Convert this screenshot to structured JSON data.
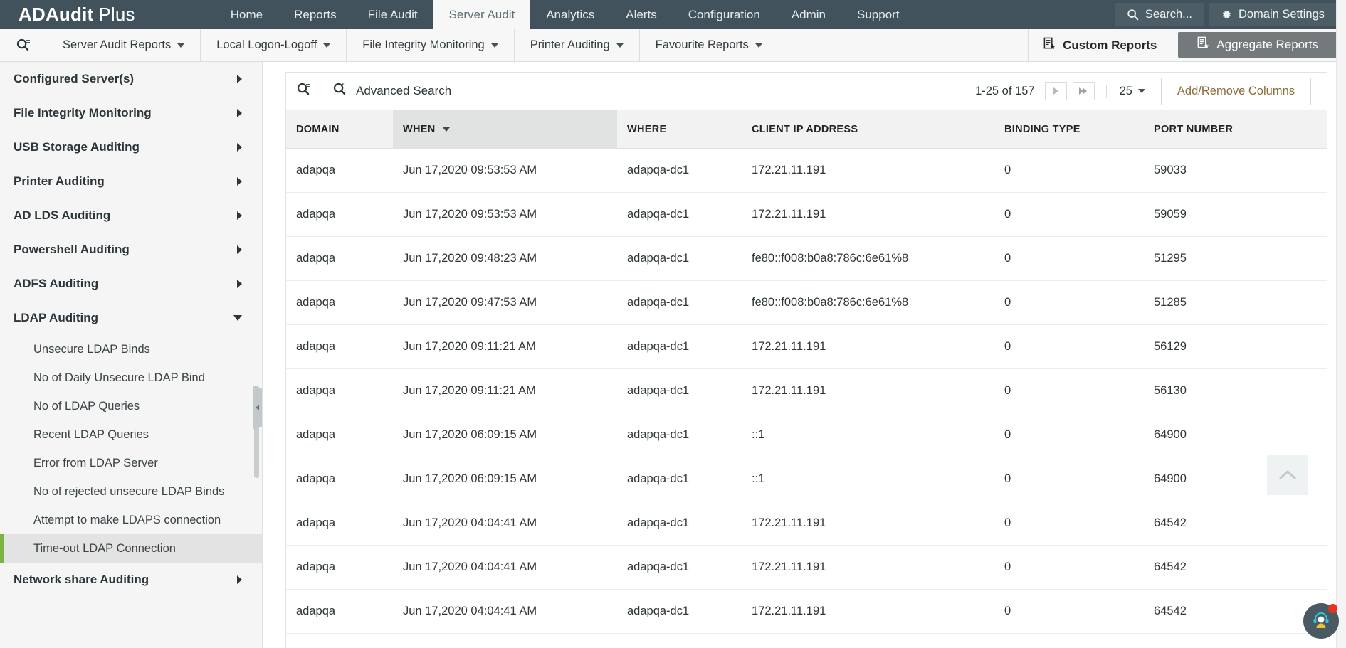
{
  "app": {
    "brand_bold": "ADAudit",
    "brand_light": "Plus",
    "accent_green": "#7cb342",
    "nav_bg": "#41525c"
  },
  "topnav": {
    "items": [
      {
        "label": "Home",
        "active": false
      },
      {
        "label": "Reports",
        "active": false
      },
      {
        "label": "File Audit",
        "active": false
      },
      {
        "label": "Server Audit",
        "active": true
      },
      {
        "label": "Analytics",
        "active": false
      },
      {
        "label": "Alerts",
        "active": false
      },
      {
        "label": "Configuration",
        "active": false
      },
      {
        "label": "Admin",
        "active": false
      },
      {
        "label": "Support",
        "active": false
      }
    ],
    "search_label": "Search...",
    "domain_settings_label": "Domain Settings"
  },
  "subnav": {
    "menus": [
      {
        "label": "Server Audit Reports"
      },
      {
        "label": "Local Logon-Logoff"
      },
      {
        "label": "File Integrity Monitoring"
      },
      {
        "label": "Printer Auditing"
      },
      {
        "label": "Favourite Reports"
      }
    ],
    "custom_reports_label": "Custom Reports",
    "aggregate_reports_label": "Aggregate Reports"
  },
  "sidebar": {
    "groups": [
      {
        "label": "Configured Server(s)",
        "expanded": false
      },
      {
        "label": "File Integrity Monitoring",
        "expanded": false
      },
      {
        "label": "USB Storage Auditing",
        "expanded": false
      },
      {
        "label": "Printer Auditing",
        "expanded": false
      },
      {
        "label": "AD LDS Auditing",
        "expanded": false
      },
      {
        "label": "Powershell Auditing",
        "expanded": false
      },
      {
        "label": "ADFS Auditing",
        "expanded": false
      },
      {
        "label": "LDAP Auditing",
        "expanded": true
      }
    ],
    "ldap_items": [
      {
        "label": "Unsecure LDAP Binds",
        "selected": false
      },
      {
        "label": "No of Daily Unsecure LDAP Bind",
        "selected": false
      },
      {
        "label": "No of LDAP Queries",
        "selected": false
      },
      {
        "label": "Recent LDAP Queries",
        "selected": false
      },
      {
        "label": "Error from LDAP Server",
        "selected": false
      },
      {
        "label": "No of rejected unsecure LDAP Binds",
        "selected": false
      },
      {
        "label": "Attempt to make LDAPS connection",
        "selected": false
      },
      {
        "label": "Time-out LDAP Connection",
        "selected": true
      }
    ],
    "last_group": {
      "label": "Network share Auditing",
      "expanded": false
    }
  },
  "toolbar": {
    "advanced_search_label": "Advanced Search",
    "record_range": "1-25 of 157",
    "page_size": "25",
    "add_remove_columns_label": "Add/Remove Columns"
  },
  "table": {
    "columns": [
      {
        "key": "domain",
        "label": "DOMAIN",
        "sorted": false
      },
      {
        "key": "when",
        "label": "WHEN",
        "sorted": true
      },
      {
        "key": "where",
        "label": "WHERE",
        "sorted": false
      },
      {
        "key": "client_ip",
        "label": "CLIENT IP ADDRESS",
        "sorted": false
      },
      {
        "key": "binding_type",
        "label": "BINDING TYPE",
        "sorted": false
      },
      {
        "key": "port_number",
        "label": "PORT NUMBER",
        "sorted": false
      }
    ],
    "rows": [
      {
        "domain": "adapqa",
        "when": "Jun 17,2020 09:53:53 AM",
        "where": "adapqa-dc1",
        "client_ip": "172.21.11.191",
        "binding_type": "0",
        "port_number": "59033"
      },
      {
        "domain": "adapqa",
        "when": "Jun 17,2020 09:53:53 AM",
        "where": "adapqa-dc1",
        "client_ip": "172.21.11.191",
        "binding_type": "0",
        "port_number": "59059"
      },
      {
        "domain": "adapqa",
        "when": "Jun 17,2020 09:48:23 AM",
        "where": "adapqa-dc1",
        "client_ip": "fe80::f008:b0a8:786c:6e61%8",
        "binding_type": "0",
        "port_number": "51295"
      },
      {
        "domain": "adapqa",
        "when": "Jun 17,2020 09:47:53 AM",
        "where": "adapqa-dc1",
        "client_ip": "fe80::f008:b0a8:786c:6e61%8",
        "binding_type": "0",
        "port_number": "51285"
      },
      {
        "domain": "adapqa",
        "when": "Jun 17,2020 09:11:21 AM",
        "where": "adapqa-dc1",
        "client_ip": "172.21.11.191",
        "binding_type": "0",
        "port_number": "56129"
      },
      {
        "domain": "adapqa",
        "when": "Jun 17,2020 09:11:21 AM",
        "where": "adapqa-dc1",
        "client_ip": "172.21.11.191",
        "binding_type": "0",
        "port_number": "56130"
      },
      {
        "domain": "adapqa",
        "when": "Jun 17,2020 06:09:15 AM",
        "where": "adapqa-dc1",
        "client_ip": "::1",
        "binding_type": "0",
        "port_number": "64900"
      },
      {
        "domain": "adapqa",
        "when": "Jun 17,2020 06:09:15 AM",
        "where": "adapqa-dc1",
        "client_ip": "::1",
        "binding_type": "0",
        "port_number": "64900"
      },
      {
        "domain": "adapqa",
        "when": "Jun 17,2020 04:04:41 AM",
        "where": "adapqa-dc1",
        "client_ip": "172.21.11.191",
        "binding_type": "0",
        "port_number": "64542"
      },
      {
        "domain": "adapqa",
        "when": "Jun 17,2020 04:04:41 AM",
        "where": "adapqa-dc1",
        "client_ip": "172.21.11.191",
        "binding_type": "0",
        "port_number": "64542"
      },
      {
        "domain": "adapqa",
        "when": "Jun 17,2020 04:04:41 AM",
        "where": "adapqa-dc1",
        "client_ip": "172.21.11.191",
        "binding_type": "0",
        "port_number": "64542"
      }
    ]
  }
}
